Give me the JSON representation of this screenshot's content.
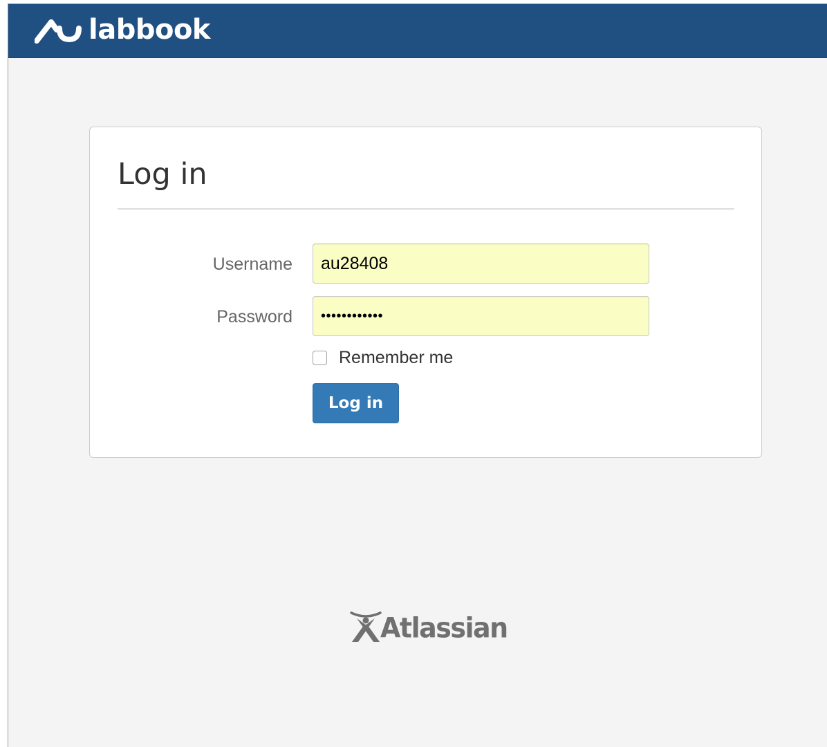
{
  "header": {
    "brand_name": "labbook",
    "brand_icon": "labbook-logo-icon",
    "background_color": "#205081"
  },
  "login": {
    "title": "Log in",
    "username_label": "Username",
    "username_value": "au28408",
    "password_label": "Password",
    "password_value": "••••••••••••",
    "remember_label": "Remember me",
    "remember_checked": false,
    "submit_label": "Log in",
    "input_autofill_color": "#fafdc4",
    "button_color": "#337ab7"
  },
  "footer": {
    "logo_text": "Atlassian",
    "logo_icon": "atlassian-logo-icon"
  }
}
